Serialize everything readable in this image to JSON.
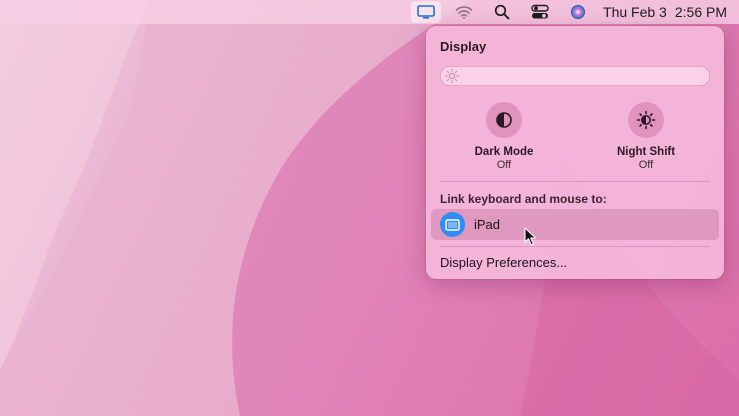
{
  "menubar": {
    "icons": [
      "display-icon",
      "wifi-icon",
      "search-icon",
      "control-center-icon",
      "siri-icon"
    ],
    "date": "Thu Feb 3",
    "time": "2:56 PM"
  },
  "display_menu": {
    "title": "Display",
    "brightness_level": 0.0,
    "toggles": [
      {
        "label": "Dark Mode",
        "state": "Off",
        "icon": "dark-mode-icon"
      },
      {
        "label": "Night Shift",
        "state": "Off",
        "icon": "night-shift-icon"
      }
    ],
    "link_section": {
      "label": "Link keyboard and mouse to:",
      "devices": [
        {
          "label": "iPad",
          "icon": "ipad-icon"
        }
      ]
    },
    "preferences_label": "Display Preferences..."
  },
  "colors": {
    "accent_blue": "#2f8cf5",
    "panel_bg": "#f4b6da"
  }
}
